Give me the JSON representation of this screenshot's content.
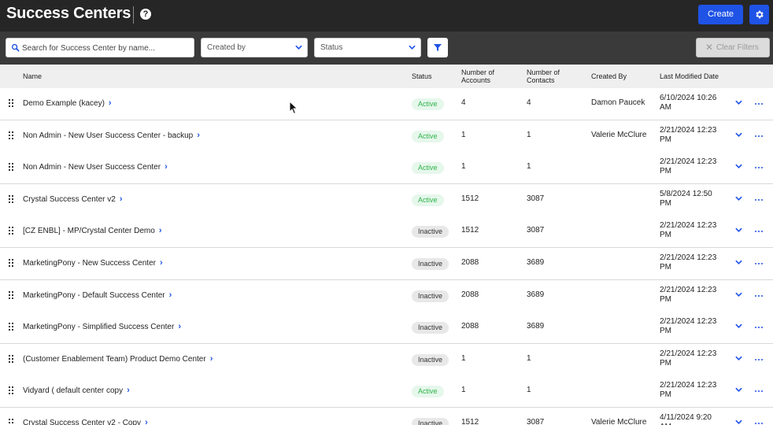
{
  "header": {
    "title": "Success Centers",
    "help_icon": "question-circle-icon",
    "create_label": "Create",
    "settings_icon": "gear-icon"
  },
  "filters": {
    "search_placeholder": "Search for Success Center by name...",
    "created_by_label": "Created by",
    "status_label": "Status",
    "filter_icon": "funnel-icon",
    "clear_label": "Clear Filters"
  },
  "columns": {
    "name": "Name",
    "status": "Status",
    "accounts_1": "Number of",
    "accounts_2": "Accounts",
    "contacts_1": "Number of",
    "contacts_2": "Contacts",
    "created_by": "Created By",
    "modified": "Last Modified Date"
  },
  "rows": [
    {
      "name": "Demo Example (kacey)",
      "status": "Active",
      "accounts": "4",
      "contacts": "4",
      "created_by": "Damon Paucek",
      "modified_1": "6/10/2024 10:26",
      "modified_2": "AM"
    },
    {
      "name": "Non Admin - New User Success Center - backup",
      "status": "Active",
      "accounts": "1",
      "contacts": "1",
      "created_by": "Valerie McClure",
      "modified_1": "2/21/2024 12:23",
      "modified_2": "PM"
    },
    {
      "name": "Non Admin - New User Success Center",
      "status": "Active",
      "accounts": "1",
      "contacts": "1",
      "created_by": "",
      "modified_1": "2/21/2024 12:23",
      "modified_2": "PM"
    },
    {
      "name": "Crystal Success Center v2",
      "status": "Active",
      "accounts": "1512",
      "contacts": "3087",
      "created_by": "",
      "modified_1": "5/8/2024 12:50",
      "modified_2": "PM"
    },
    {
      "name": "[CZ ENBL] - MP/Crystal Center Demo",
      "status": "Inactive",
      "accounts": "1512",
      "contacts": "3087",
      "created_by": "",
      "modified_1": "2/21/2024 12:23",
      "modified_2": "PM"
    },
    {
      "name": "MarketingPony - New Success Center",
      "status": "Inactive",
      "accounts": "2088",
      "contacts": "3689",
      "created_by": "",
      "modified_1": "2/21/2024 12:23",
      "modified_2": "PM"
    },
    {
      "name": "MarketingPony - Default Success Center",
      "status": "Inactive",
      "accounts": "2088",
      "contacts": "3689",
      "created_by": "",
      "modified_1": "2/21/2024 12:23",
      "modified_2": "PM"
    },
    {
      "name": "MarketingPony - Simplified Success Center",
      "status": "Inactive",
      "accounts": "2088",
      "contacts": "3689",
      "created_by": "",
      "modified_1": "2/21/2024 12:23",
      "modified_2": "PM"
    },
    {
      "name": "(Customer Enablement Team) Product Demo Center",
      "status": "Inactive",
      "accounts": "1",
      "contacts": "1",
      "created_by": "",
      "modified_1": "2/21/2024 12:23",
      "modified_2": "PM"
    },
    {
      "name": "Vidyard ( default center copy",
      "status": "Active",
      "accounts": "1",
      "contacts": "1",
      "created_by": "",
      "modified_1": "2/21/2024 12:23",
      "modified_2": "PM"
    },
    {
      "name": "Crystal Success Center v2 - Copy",
      "status": "Inactive",
      "accounts": "1512",
      "contacts": "3087",
      "created_by": "Valerie McClure",
      "modified_1": "4/11/2024 9:20",
      "modified_2": "AM"
    }
  ],
  "colors": {
    "header_bg": "#262626",
    "filterbar_bg": "#3a3a3a",
    "accent": "#1f53e6",
    "active_text": "#2fb34a",
    "active_bg": "#e6f7ec",
    "inactive_bg": "#e8e8e8"
  }
}
